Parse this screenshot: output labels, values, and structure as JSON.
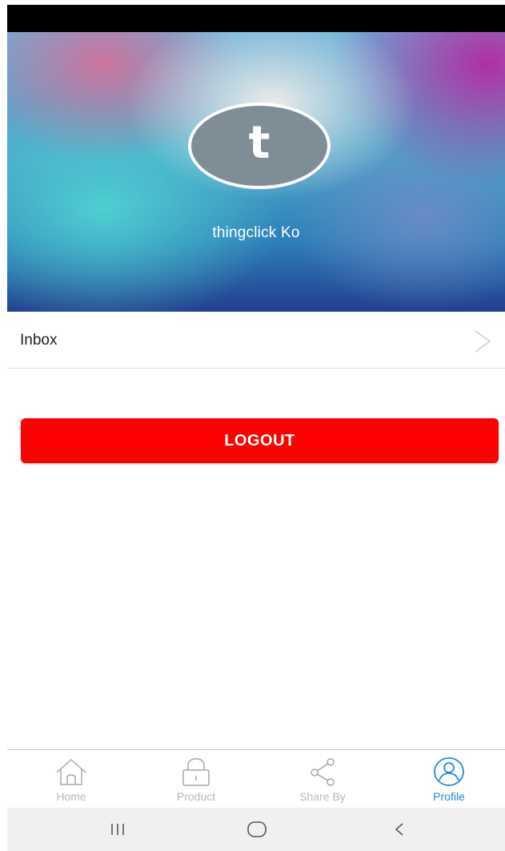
{
  "profile": {
    "avatar_letter": "t",
    "username": "thingclick Ko"
  },
  "menu": {
    "inbox_label": "Inbox"
  },
  "actions": {
    "logout_label": "LOGOUT"
  },
  "tabs": [
    {
      "label": "Home",
      "icon": "home-icon",
      "active": false
    },
    {
      "label": "Product",
      "icon": "lock-icon",
      "active": false
    },
    {
      "label": "Share By",
      "icon": "share-icon",
      "active": false
    },
    {
      "label": "Profile",
      "icon": "profile-icon",
      "active": true
    }
  ],
  "system_nav": {
    "icons": [
      "recent-apps-icon",
      "home-circle-icon",
      "back-icon"
    ]
  },
  "colors": {
    "accent": "#1a8fd0",
    "logout": "#ff0000",
    "avatar_bg": "#7f8d97",
    "tab_inactive": "#b9b9b9"
  }
}
